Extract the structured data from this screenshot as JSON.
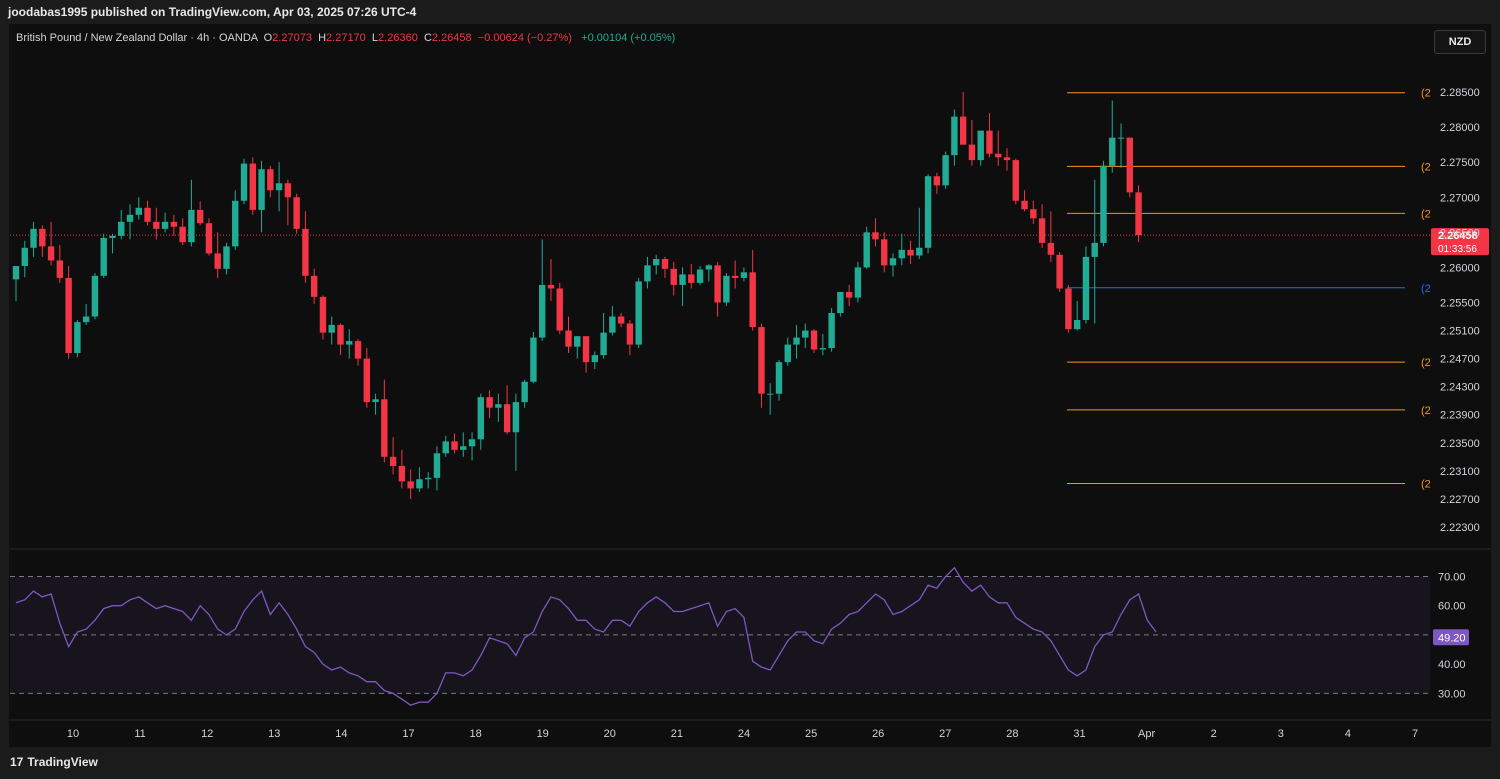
{
  "header": {
    "published_by": "joodabas1995 published on TradingView.com, Apr 03, 2025 07:26 UTC-4"
  },
  "symbol": {
    "name": "British Pound / New Zealand Dollar · 4h · OANDA",
    "open_label": "O",
    "open": "2.27073",
    "high_label": "H",
    "high": "2.27170",
    "low_label": "L",
    "low": "2.26360",
    "close_label": "C",
    "close": "2.26458",
    "change": "−0.00624 (−0.27%)",
    "extra": "+0.00104 (+0.05%)"
  },
  "currency": "NZD",
  "last_price": {
    "value": "2.26458",
    "countdown": "01:33:56"
  },
  "rsi_current": "49.20",
  "footer": {
    "brand": "TradingView"
  },
  "colors": {
    "bull": "#22ab94",
    "bear": "#f23645",
    "rsi": "#7e57c2",
    "fib": "#f7931a",
    "fib_blue": "#2962ff"
  },
  "chart_data": [
    {
      "type": "candlestick",
      "title": "British Pound / New Zealand Dollar · 4h · OANDA",
      "ylim": [
        2.221,
        2.288
      ],
      "y_ticks": [
        "2.28500",
        "2.28000",
        "2.27500",
        "2.27000",
        "2.26500",
        "2.26000",
        "2.25500",
        "2.25100",
        "2.24700",
        "2.24300",
        "2.23900",
        "2.23500",
        "2.23100",
        "2.22700",
        "2.22300"
      ],
      "x_ticks": [
        "10",
        "11",
        "12",
        "13",
        "14",
        "17",
        "18",
        "19",
        "20",
        "21",
        "24",
        "25",
        "26",
        "27",
        "28",
        "31",
        "Apr",
        "2",
        "3",
        "4",
        "7"
      ],
      "fib_levels": [
        {
          "label": "(2",
          "value": 2.2849,
          "color": "orange"
        },
        {
          "label": "(2",
          "value": 2.2744,
          "color": "orange"
        },
        {
          "label": "(2",
          "value": 2.2677,
          "color": "orange"
        },
        {
          "label": "(2",
          "value": 2.2571,
          "color": "blue"
        },
        {
          "label": "(2",
          "value": 2.2465,
          "color": "orange"
        },
        {
          "label": "(2",
          "value": 2.2397,
          "color": "orange"
        },
        {
          "label": "(2",
          "value": 2.2292,
          "color": "orange"
        }
      ],
      "candles": [
        [
          2.2583,
          2.2602,
          2.2552,
          2.2602
        ],
        [
          2.2602,
          2.2638,
          2.2586,
          2.2628
        ],
        [
          2.2628,
          2.2665,
          2.2615,
          2.2655
        ],
        [
          2.2655,
          2.266,
          2.2615,
          2.263
        ],
        [
          2.263,
          2.2665,
          2.2603,
          2.261
        ],
        [
          2.261,
          2.2632,
          2.2578,
          2.2585
        ],
        [
          2.2585,
          2.2602,
          2.247,
          2.2478
        ],
        [
          2.2478,
          2.2525,
          2.2472,
          2.2522
        ],
        [
          2.2522,
          2.2548,
          2.2518,
          2.253
        ],
        [
          2.253,
          2.2592,
          2.2526,
          2.2588
        ],
        [
          2.2588,
          2.2648,
          2.2585,
          2.2642
        ],
        [
          2.2642,
          2.2648,
          2.262,
          2.2645
        ],
        [
          2.2645,
          2.2682,
          2.264,
          2.2665
        ],
        [
          2.2665,
          2.269,
          2.264,
          2.2675
        ],
        [
          2.2675,
          2.27,
          2.2668,
          2.2685
        ],
        [
          2.2685,
          2.2695,
          2.266,
          2.2665
        ],
        [
          2.2665,
          2.2685,
          2.264,
          2.2655
        ],
        [
          2.2655,
          2.2678,
          2.265,
          2.2665
        ],
        [
          2.2665,
          2.2675,
          2.2645,
          2.2658
        ],
        [
          2.2658,
          2.267,
          2.2632,
          2.2636
        ],
        [
          2.2636,
          2.2725,
          2.263,
          2.2682
        ],
        [
          2.2682,
          2.2694,
          2.266,
          2.2663
        ],
        [
          2.2663,
          2.267,
          2.2617,
          2.262
        ],
        [
          2.262,
          2.265,
          2.2585,
          2.2598
        ],
        [
          2.2598,
          2.2635,
          2.259,
          2.263
        ],
        [
          2.263,
          2.271,
          2.2625,
          2.2695
        ],
        [
          2.2695,
          2.2755,
          2.269,
          2.2748
        ],
        [
          2.2748,
          2.2757,
          2.2675,
          2.2682
        ],
        [
          2.2682,
          2.2752,
          2.265,
          2.274
        ],
        [
          2.274,
          2.2745,
          2.27,
          2.271
        ],
        [
          2.271,
          2.275,
          2.268,
          2.272
        ],
        [
          2.272,
          2.2725,
          2.266,
          2.27
        ],
        [
          2.27,
          2.2705,
          2.2648,
          2.2655
        ],
        [
          2.2655,
          2.268,
          2.2578,
          2.2588
        ],
        [
          2.2588,
          2.2598,
          2.2548,
          2.2558
        ],
        [
          2.2558,
          2.256,
          2.2497,
          2.2507
        ],
        [
          2.2507,
          2.253,
          2.249,
          2.2518
        ],
        [
          2.2518,
          2.252,
          2.2475,
          2.249
        ],
        [
          2.249,
          2.2512,
          2.247,
          2.2495
        ],
        [
          2.2495,
          2.2498,
          2.246,
          2.247
        ],
        [
          2.247,
          2.2485,
          2.24,
          2.2408
        ],
        [
          2.2408,
          2.242,
          2.239,
          2.2412
        ],
        [
          2.2412,
          2.244,
          2.2322,
          2.233
        ],
        [
          2.233,
          2.2358,
          2.2305,
          2.2317
        ],
        [
          2.2317,
          2.234,
          2.2285,
          2.2295
        ],
        [
          2.2295,
          2.2312,
          2.227,
          2.2285
        ],
        [
          2.2285,
          2.2315,
          2.228,
          2.2298
        ],
        [
          2.2298,
          2.2308,
          2.2285,
          2.23
        ],
        [
          2.23,
          2.2345,
          2.2282,
          2.2335
        ],
        [
          2.2335,
          2.236,
          2.233,
          2.2352
        ],
        [
          2.2352,
          2.2363,
          2.2335,
          2.234
        ],
        [
          2.234,
          2.2365,
          2.233,
          2.2345
        ],
        [
          2.2345,
          2.2365,
          2.2325,
          2.2355
        ],
        [
          2.2355,
          2.242,
          2.234,
          2.2415
        ],
        [
          2.2415,
          2.2425,
          2.2385,
          2.24
        ],
        [
          2.24,
          2.242,
          2.238,
          2.2405
        ],
        [
          2.2405,
          2.2432,
          2.2362,
          2.2365
        ],
        [
          2.2365,
          2.242,
          2.231,
          2.2408
        ],
        [
          2.2408,
          2.244,
          2.24,
          2.2437
        ],
        [
          2.2437,
          2.2508,
          2.2435,
          2.25
        ],
        [
          2.25,
          2.264,
          2.2495,
          2.2575
        ],
        [
          2.2575,
          2.2612,
          2.2552,
          2.257
        ],
        [
          2.257,
          2.2578,
          2.2505,
          2.251
        ],
        [
          2.251,
          2.253,
          2.2478,
          2.2487
        ],
        [
          2.2487,
          2.2502,
          2.247,
          2.2502
        ],
        [
          2.2502,
          2.2502,
          2.245,
          2.2465
        ],
        [
          2.2465,
          2.248,
          2.2455,
          2.2475
        ],
        [
          2.2475,
          2.2535,
          2.247,
          2.2507
        ],
        [
          2.2507,
          2.2545,
          2.2503,
          2.253
        ],
        [
          2.253,
          2.2535,
          2.2515,
          2.252
        ],
        [
          2.252,
          2.2525,
          2.2475,
          2.249
        ],
        [
          2.249,
          2.2585,
          2.2485,
          2.258
        ],
        [
          2.258,
          2.2615,
          2.257,
          2.2603
        ],
        [
          2.2603,
          2.2618,
          2.259,
          2.2612
        ],
        [
          2.2612,
          2.2615,
          2.2585,
          2.2598
        ],
        [
          2.2598,
          2.2608,
          2.256,
          2.2575
        ],
        [
          2.2575,
          2.26,
          2.2545,
          2.259
        ],
        [
          2.259,
          2.2605,
          2.257,
          2.2578
        ],
        [
          2.2578,
          2.2602,
          2.2575,
          2.2597
        ],
        [
          2.2597,
          2.2605,
          2.258,
          2.2603
        ],
        [
          2.2603,
          2.2608,
          2.253,
          2.255
        ],
        [
          2.255,
          2.2592,
          2.2545,
          2.2588
        ],
        [
          2.2588,
          2.261,
          2.257,
          2.2585
        ],
        [
          2.2585,
          2.26,
          2.258,
          2.2593
        ],
        [
          2.2593,
          2.2625,
          2.251,
          2.2515
        ],
        [
          2.2515,
          2.252,
          2.24,
          2.242
        ],
        [
          2.242,
          2.2435,
          2.239,
          2.242
        ],
        [
          2.242,
          2.2468,
          2.241,
          2.2465
        ],
        [
          2.2465,
          2.25,
          2.246,
          2.249
        ],
        [
          2.249,
          2.2518,
          2.247,
          2.25
        ],
        [
          2.25,
          2.252,
          2.2485,
          2.251
        ],
        [
          2.251,
          2.2512,
          2.2478,
          2.2483
        ],
        [
          2.2483,
          2.2505,
          2.2475,
          2.2485
        ],
        [
          2.2485,
          2.2542,
          2.248,
          2.2535
        ],
        [
          2.2535,
          2.2565,
          2.253,
          2.2565
        ],
        [
          2.2565,
          2.2575,
          2.2545,
          2.2557
        ],
        [
          2.2557,
          2.2608,
          2.255,
          2.26
        ],
        [
          2.26,
          2.2658,
          2.2598,
          2.265
        ],
        [
          2.265,
          2.267,
          2.263,
          2.264
        ],
        [
          2.264,
          2.265,
          2.2593,
          2.2603
        ],
        [
          2.2603,
          2.262,
          2.2587,
          2.2613
        ],
        [
          2.2613,
          2.2648,
          2.2603,
          2.2625
        ],
        [
          2.2625,
          2.2638,
          2.2605,
          2.2617
        ],
        [
          2.2617,
          2.2685,
          2.2612,
          2.2628
        ],
        [
          2.2628,
          2.2733,
          2.262,
          2.273
        ],
        [
          2.273,
          2.2735,
          2.2705,
          2.2717
        ],
        [
          2.2717,
          2.2765,
          2.2712,
          2.276
        ],
        [
          2.276,
          2.2825,
          2.2745,
          2.2815
        ],
        [
          2.2815,
          2.285,
          2.2775,
          2.2775
        ],
        [
          2.2775,
          2.281,
          2.2745,
          2.2753
        ],
        [
          2.2753,
          2.2795,
          2.2745,
          2.2795
        ],
        [
          2.2795,
          2.282,
          2.2757,
          2.2762
        ],
        [
          2.2762,
          2.2795,
          2.2745,
          2.2757
        ],
        [
          2.2757,
          2.277,
          2.2738,
          2.2753
        ],
        [
          2.2753,
          2.2755,
          2.269,
          2.2695
        ],
        [
          2.2695,
          2.271,
          2.268,
          2.2683
        ],
        [
          2.2683,
          2.2695,
          2.2662,
          2.267
        ],
        [
          2.267,
          2.269,
          2.2628,
          2.2635
        ],
        [
          2.2635,
          2.268,
          2.2608,
          2.2618
        ],
        [
          2.2618,
          2.2622,
          2.2565,
          2.257
        ],
        [
          2.257,
          2.2575,
          2.2507,
          2.2512
        ],
        [
          2.2512,
          2.2552,
          2.251,
          2.2525
        ],
        [
          2.2525,
          2.263,
          2.252,
          2.2615
        ],
        [
          2.2615,
          2.2725,
          2.252,
          2.2635
        ],
        [
          2.2635,
          2.2752,
          2.263,
          2.2745
        ],
        [
          2.2745,
          2.2838,
          2.2735,
          2.2785
        ],
        [
          2.2785,
          2.2805,
          2.2742,
          2.2785
        ],
        [
          2.2785,
          2.2785,
          2.27,
          2.2707
        ],
        [
          2.2707,
          2.2717,
          2.2636,
          2.2646
        ]
      ]
    },
    {
      "type": "line",
      "title": "RSI",
      "ylim": [
        25,
        77
      ],
      "y_ticks": [
        "70.00",
        "60.00",
        "50.00",
        "40.00",
        "30.00"
      ],
      "bands": [
        70,
        50,
        30
      ],
      "values": [
        61,
        62,
        65,
        63,
        64,
        54,
        46,
        51,
        52,
        55,
        59,
        60,
        60,
        62,
        63,
        61,
        59,
        60,
        59,
        58,
        55,
        60,
        57,
        52,
        50,
        52,
        58,
        62,
        65,
        57,
        61,
        57,
        52,
        46,
        44,
        40,
        38,
        39,
        37,
        36,
        34,
        34,
        31,
        30,
        28,
        26,
        27,
        27,
        30,
        37,
        37,
        36,
        38,
        43,
        49,
        48,
        47,
        43,
        49,
        51,
        58,
        63,
        62,
        59,
        55,
        55,
        52,
        51,
        55,
        55,
        53,
        58,
        61,
        63,
        61,
        58,
        58,
        59,
        60,
        61,
        53,
        58,
        59,
        56,
        41,
        39,
        38,
        43,
        48,
        51,
        51,
        48,
        47,
        52,
        54,
        57,
        58,
        61,
        64,
        62,
        57,
        58,
        60,
        62,
        67,
        66,
        70,
        73,
        68,
        65,
        67,
        63,
        61,
        61,
        56,
        54,
        52,
        51,
        48,
        43,
        38,
        36,
        38,
        46,
        50,
        51,
        57,
        62,
        64,
        55,
        51
      ]
    }
  ]
}
